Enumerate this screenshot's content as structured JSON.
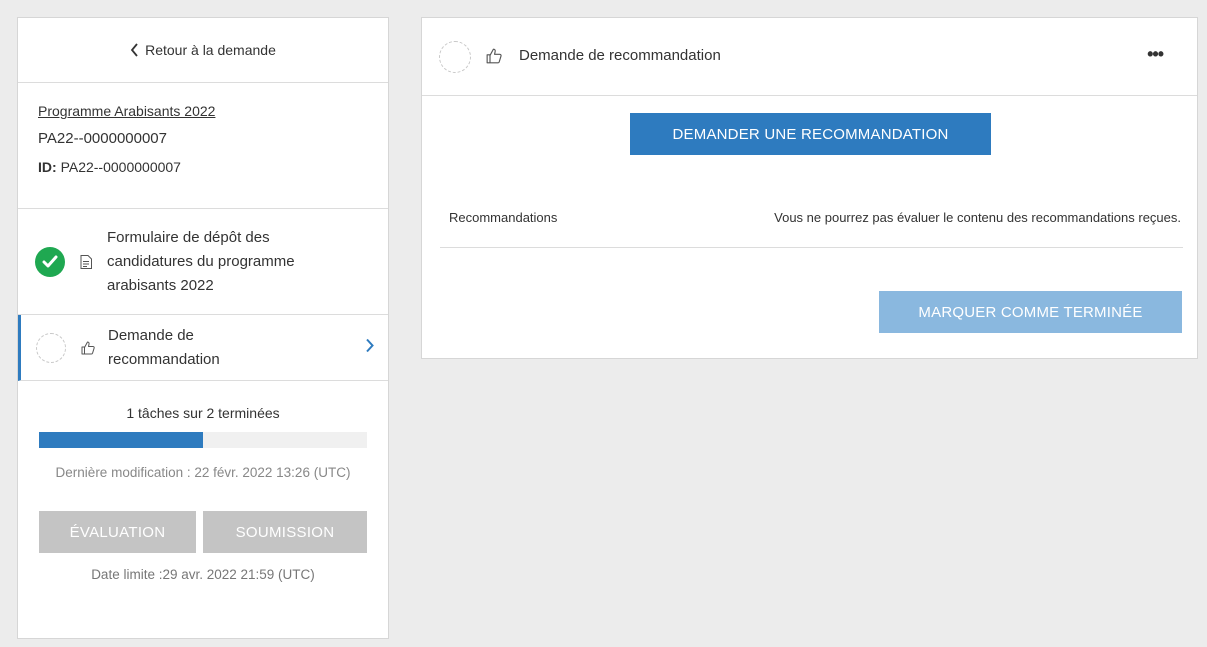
{
  "sidebar": {
    "back_label": "Retour à la demande",
    "program_link": "Programme Arabisants 2022",
    "application_code": "PA22--0000000007",
    "id_label": "ID:",
    "id_value": "PA22--0000000007",
    "tasks": [
      {
        "label": "Formulaire de dépôt des candidatures du programme arabisants 2022",
        "status": "completed",
        "icon": "document-icon"
      },
      {
        "label": "Demande de recommandation",
        "status": "pending",
        "icon": "thumbs-up-icon",
        "active": true
      }
    ],
    "progress_text": "1 tâches sur 2 terminées",
    "progress_fraction": 0.5,
    "last_modified": "Dernière modification : 22 févr. 2022 13:26 (UTC)",
    "evaluation_button": "ÉVALUATION",
    "submission_button": "SOUMISSION",
    "deadline": "Date limite :29 avr. 2022 21:59 (UTC)"
  },
  "main": {
    "title": "Demande de recommandation",
    "more_label": "•••",
    "request_button": "DEMANDER UNE RECOMMANDATION",
    "recommendations_label": "Recommandations",
    "recommendations_note": "Vous ne pourrez pas évaluer le contenu des recommandations reçues.",
    "mark_done_button": "MARQUER COMME TERMINÉE"
  },
  "colors": {
    "accent": "#2e7bbf",
    "success": "#1fa851",
    "disabled": "#c4c4c4",
    "accent_light": "#8ab8df"
  }
}
